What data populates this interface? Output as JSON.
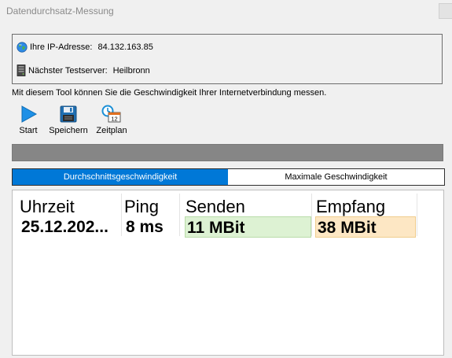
{
  "window": {
    "title": "Datendurchsatz-Messung"
  },
  "info": {
    "ip_label": "Ihre IP-Adresse:",
    "ip_value": "84.132.163.85",
    "server_label": "Nächster Testserver:",
    "server_value": "Heilbronn"
  },
  "description": "Mit diesem Tool können Sie die Geschwindigkeit Ihrer Internetverbindung messen.",
  "toolbar": {
    "start_label": "Start",
    "save_label": "Speichern",
    "schedule_label": "Zeitplan",
    "schedule_icon_number": "12"
  },
  "progress": {
    "value_percent": 0
  },
  "tabs": [
    {
      "label": "Durchschnittsgeschwindigkeit",
      "active": true
    },
    {
      "label": "Maximale Geschwindigkeit",
      "active": false
    }
  ],
  "results": {
    "columns": [
      "Uhrzeit",
      "Ping",
      "Senden",
      "Empfang"
    ],
    "row": {
      "time": "25.12.202...",
      "ping": "8 ms",
      "send": "11 MBit",
      "receive": "38 MBit"
    }
  },
  "colors": {
    "accent": "#0078d7",
    "send_bg": "#ddf2d3",
    "receive_bg": "#fde7c4",
    "progress_track": "#868686"
  },
  "icons": {
    "ip": "globe-icon",
    "server": "server-icon",
    "start": "play-icon",
    "save": "floppy-disk-icon",
    "schedule": "clock-calendar-icon",
    "close": "close-icon"
  }
}
